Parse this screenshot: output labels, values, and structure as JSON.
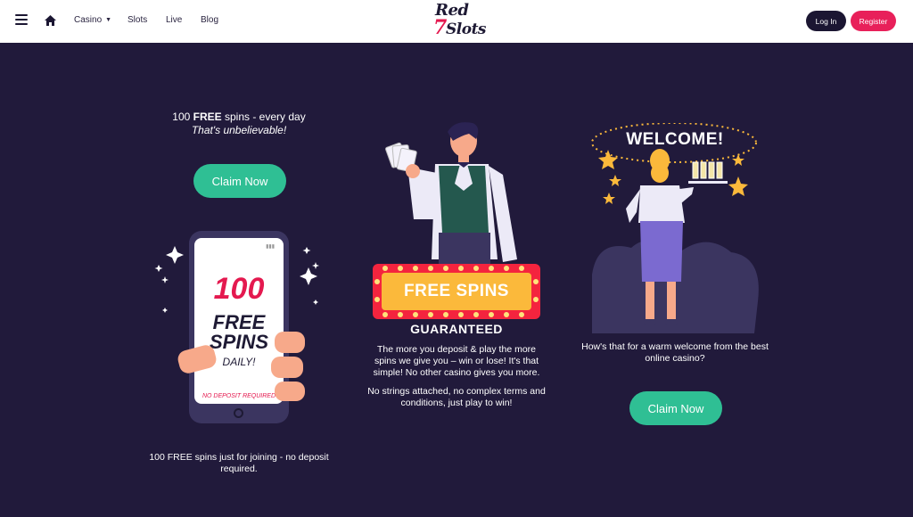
{
  "header": {
    "menu_icon": "hamburger-icon",
    "home_icon": "home-icon",
    "nav": [
      {
        "label": "Casino",
        "has_dropdown": true
      },
      {
        "label": "Slots"
      },
      {
        "label": "Live"
      },
      {
        "label": "Blog"
      }
    ],
    "logo": {
      "line1": "Red",
      "seven": "7",
      "line2": "Slots"
    },
    "login_label": "Log In",
    "register_label": "Register"
  },
  "left": {
    "headline_prefix": "100 ",
    "headline_bold": "FREE",
    "headline_suffix": " spins - every day",
    "subline": "That's unbelievable!",
    "claim_label": "Claim Now",
    "phone": {
      "big": "100",
      "free": "FREE",
      "spins": "SPINS",
      "daily": "DAILY!",
      "no_deposit": "NO DEPOSIT REQUIRED"
    },
    "caption": "100 FREE spins just for joining - no deposit required."
  },
  "center": {
    "banner_text": "FREE SPINS",
    "banner_sub": "GUARANTEED",
    "para1": "The more you deposit & play the more spins we give you – win or lose! It's that simple! No other casino gives you more.",
    "para2": "No strings attached, no complex terms and conditions, just play to win!"
  },
  "right": {
    "welcome_sign": "WELCOME!",
    "caption": "How's that for a warm welcome from the best online casino?",
    "claim_label": "Claim Now"
  },
  "colors": {
    "background": "#211a3b",
    "accent_green": "#2fbf94",
    "brand_red": "#e8205a",
    "dark": "#1b1632"
  }
}
